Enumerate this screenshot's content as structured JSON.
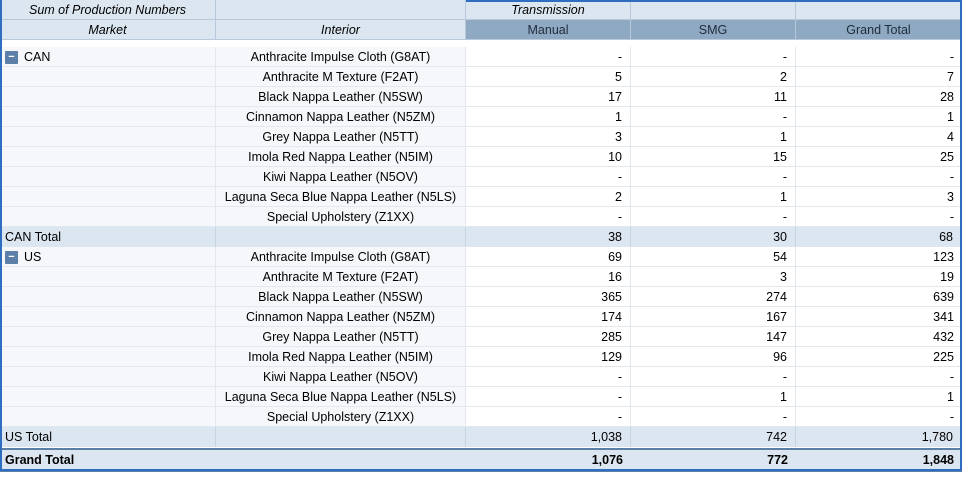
{
  "header": {
    "measure_label": "Sum of Production Numbers",
    "column_field_label": "Transmission",
    "row_field_label": "Market",
    "row_subfield_label": "Interior",
    "column_labels": [
      "Manual",
      "SMG",
      "Grand Total"
    ]
  },
  "groups": [
    {
      "market": "CAN",
      "rows": [
        {
          "interior": "Anthracite Impulse Cloth (G8AT)",
          "manual": "-",
          "smg": "-",
          "total": "-"
        },
        {
          "interior": "Anthracite M Texture (F2AT)",
          "manual": "5",
          "smg": "2",
          "total": "7"
        },
        {
          "interior": "Black Nappa Leather (N5SW)",
          "manual": "17",
          "smg": "11",
          "total": "28"
        },
        {
          "interior": "Cinnamon Nappa Leather (N5ZM)",
          "manual": "1",
          "smg": "-",
          "total": "1"
        },
        {
          "interior": "Grey Nappa Leather (N5TT)",
          "manual": "3",
          "smg": "1",
          "total": "4"
        },
        {
          "interior": "Imola Red Nappa Leather (N5IM)",
          "manual": "10",
          "smg": "15",
          "total": "25"
        },
        {
          "interior": "Kiwi Nappa Leather (N5OV)",
          "manual": "-",
          "smg": "-",
          "total": "-"
        },
        {
          "interior": "Laguna Seca Blue Nappa Leather (N5LS)",
          "manual": "2",
          "smg": "1",
          "total": "3"
        },
        {
          "interior": "Special Upholstery (Z1XX)",
          "manual": "-",
          "smg": "-",
          "total": "-"
        }
      ],
      "total_label": "CAN Total",
      "total": {
        "manual": "38",
        "smg": "30",
        "total": "68"
      }
    },
    {
      "market": "US",
      "rows": [
        {
          "interior": "Anthracite Impulse Cloth (G8AT)",
          "manual": "69",
          "smg": "54",
          "total": "123"
        },
        {
          "interior": "Anthracite M Texture (F2AT)",
          "manual": "16",
          "smg": "3",
          "total": "19"
        },
        {
          "interior": "Black Nappa Leather (N5SW)",
          "manual": "365",
          "smg": "274",
          "total": "639"
        },
        {
          "interior": "Cinnamon Nappa Leather (N5ZM)",
          "manual": "174",
          "smg": "167",
          "total": "341"
        },
        {
          "interior": "Grey Nappa Leather (N5TT)",
          "manual": "285",
          "smg": "147",
          "total": "432"
        },
        {
          "interior": "Imola Red Nappa Leather (N5IM)",
          "manual": "129",
          "smg": "96",
          "total": "225"
        },
        {
          "interior": "Kiwi Nappa Leather (N5OV)",
          "manual": "-",
          "smg": "-",
          "total": "-"
        },
        {
          "interior": "Laguna Seca Blue Nappa Leather (N5LS)",
          "manual": "-",
          "smg": "1",
          "total": "1"
        },
        {
          "interior": "Special Upholstery (Z1XX)",
          "manual": "-",
          "smg": "-",
          "total": "-"
        }
      ],
      "total_label": "US Total",
      "total": {
        "manual": "1,038",
        "smg": "742",
        "total": "1,780"
      }
    }
  ],
  "grand_total": {
    "label": "Grand Total",
    "manual": "1,076",
    "smg": "772",
    "total": "1,848"
  },
  "toggle_icon": "collapse-minus-icon",
  "colors": {
    "header_bg": "#dce6f1",
    "column_header_bg": "#8ea9c1",
    "selection_border": "#2e6dbf"
  }
}
